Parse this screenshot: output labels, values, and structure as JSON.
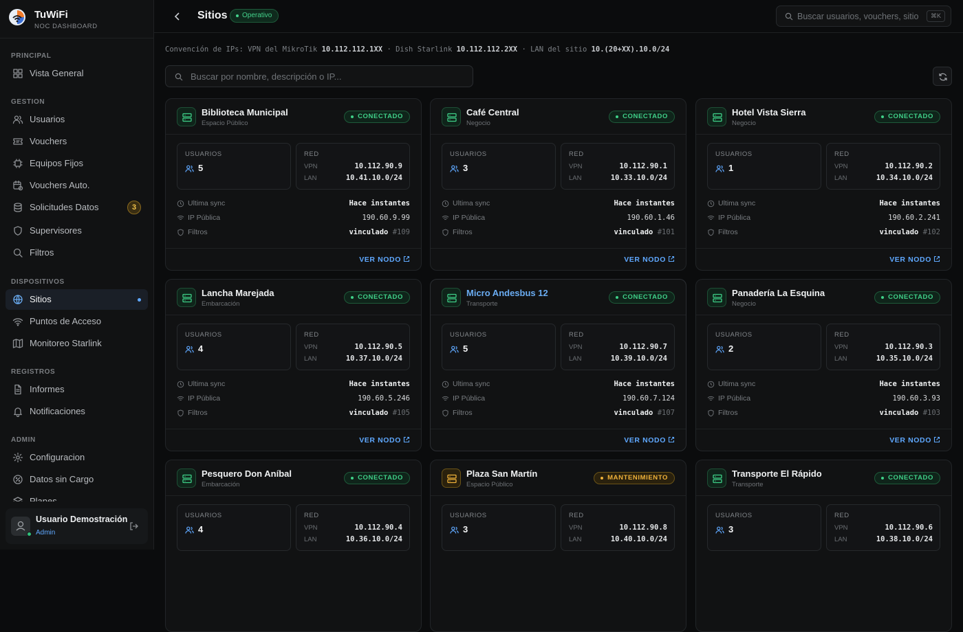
{
  "brand": {
    "name": "TuWiFi",
    "subtitle": "NOC DASHBOARD"
  },
  "sidebar": {
    "sections": [
      {
        "title": "PRINCIPAL",
        "items": [
          {
            "label": "Vista General",
            "icon": "grid-icon"
          }
        ]
      },
      {
        "title": "GESTION",
        "items": [
          {
            "label": "Usuarios",
            "icon": "users-icon"
          },
          {
            "label": "Vouchers",
            "icon": "ticket-icon"
          },
          {
            "label": "Equipos Fijos",
            "icon": "chip-icon"
          },
          {
            "label": "Vouchers Auto.",
            "icon": "calendar-clock-icon"
          },
          {
            "label": "Solicitudes Datos",
            "icon": "database-icon",
            "badge": "3"
          },
          {
            "label": "Supervisores",
            "icon": "shield-icon"
          },
          {
            "label": "Filtros",
            "icon": "search-icon"
          }
        ]
      },
      {
        "title": "DISPOSITIVOS",
        "items": [
          {
            "label": "Sitios",
            "icon": "globe-icon",
            "active": true
          },
          {
            "label": "Puntos de Acceso",
            "icon": "wifi-icon"
          },
          {
            "label": "Monitoreo Starlink",
            "icon": "map-icon"
          }
        ]
      },
      {
        "title": "REGISTROS",
        "items": [
          {
            "label": "Informes",
            "icon": "file-icon"
          },
          {
            "label": "Notificaciones",
            "icon": "bell-icon"
          }
        ]
      },
      {
        "title": "ADMIN",
        "items": [
          {
            "label": "Configuracion",
            "icon": "gear-icon"
          },
          {
            "label": "Datos sin Cargo",
            "icon": "percent-icon"
          },
          {
            "label": "Planes",
            "icon": "layers-icon"
          }
        ]
      }
    ]
  },
  "user": {
    "name": "Usuario Demostración",
    "role": "Admin"
  },
  "header": {
    "title": "Sitios",
    "status": "Operativo",
    "search_placeholder": "Buscar usuarios, vouchers, sitio",
    "shortcut": "⌘K"
  },
  "convention": {
    "prefix": "Convención de IPs: VPN del MikroTik",
    "vpn": "10.112.112.1XX",
    "dish_label": "· Dish Starlink",
    "dish": "10.112.112.2XX",
    "lan_label": "· LAN del sitio",
    "lan": "10.(20+XX).10.0/24"
  },
  "filter": {
    "placeholder": "Buscar por nombre, descripción o IP..."
  },
  "labels": {
    "usuarios": "USUARIOS",
    "red": "RED",
    "vpn": "VPN",
    "lan": "LAN",
    "ultima_sync": "Ultima sync",
    "ip_publica": "IP Pública",
    "filtros": "Filtros",
    "ver_nodo": "VER NODO"
  },
  "sites": [
    {
      "name": "Biblioteca Municipal",
      "type": "Espacio Público",
      "status": "CONECTADO",
      "status_kind": "ok",
      "users": "5",
      "vpn": "10.112.90.9",
      "lan": "10.41.10.0/24",
      "sync": "Hace instantes",
      "public_ip": "190.60.9.99",
      "filter_state": "vinculado",
      "filter_id": "#109"
    },
    {
      "name": "Café Central",
      "type": "Negocio",
      "status": "CONECTADO",
      "status_kind": "ok",
      "users": "3",
      "vpn": "10.112.90.1",
      "lan": "10.33.10.0/24",
      "sync": "Hace instantes",
      "public_ip": "190.60.1.46",
      "filter_state": "vinculado",
      "filter_id": "#101"
    },
    {
      "name": "Hotel Vista Sierra",
      "type": "Negocio",
      "status": "CONECTADO",
      "status_kind": "ok",
      "users": "1",
      "vpn": "10.112.90.2",
      "lan": "10.34.10.0/24",
      "sync": "Hace instantes",
      "public_ip": "190.60.2.241",
      "filter_state": "vinculado",
      "filter_id": "#102"
    },
    {
      "name": "Lancha Marejada",
      "type": "Embarcación",
      "status": "CONECTADO",
      "status_kind": "ok",
      "users": "4",
      "vpn": "10.112.90.5",
      "lan": "10.37.10.0/24",
      "sync": "Hace instantes",
      "public_ip": "190.60.5.246",
      "filter_state": "vinculado",
      "filter_id": "#105"
    },
    {
      "name": "Micro Andesbus 12",
      "type": "Transporte",
      "status": "CONECTADO",
      "status_kind": "ok",
      "users": "5",
      "vpn": "10.112.90.7",
      "lan": "10.39.10.0/24",
      "sync": "Hace instantes",
      "public_ip": "190.60.7.124",
      "filter_state": "vinculado",
      "filter_id": "#107",
      "hover": true
    },
    {
      "name": "Panadería La Esquina",
      "type": "Negocio",
      "status": "CONECTADO",
      "status_kind": "ok",
      "users": "2",
      "vpn": "10.112.90.3",
      "lan": "10.35.10.0/24",
      "sync": "Hace instantes",
      "public_ip": "190.60.3.93",
      "filter_state": "vinculado",
      "filter_id": "#103"
    },
    {
      "name": "Pesquero Don Aníbal",
      "type": "Embarcación",
      "status": "CONECTADO",
      "status_kind": "ok",
      "users": "4",
      "vpn": "10.112.90.4",
      "lan": "10.36.10.0/24"
    },
    {
      "name": "Plaza San Martín",
      "type": "Espacio Público",
      "status": "MANTENIMIENTO",
      "status_kind": "warn",
      "users": "3",
      "vpn": "10.112.90.8",
      "lan": "10.40.10.0/24"
    },
    {
      "name": "Transporte El Rápido",
      "type": "Transporte",
      "status": "CONECTADO",
      "status_kind": "ok",
      "users": "3",
      "vpn": "10.112.90.6",
      "lan": "10.38.10.0/24"
    }
  ],
  "colors": {
    "ok": "#3fd088",
    "warn": "#f0b23a",
    "accent": "#5fa8ff"
  }
}
